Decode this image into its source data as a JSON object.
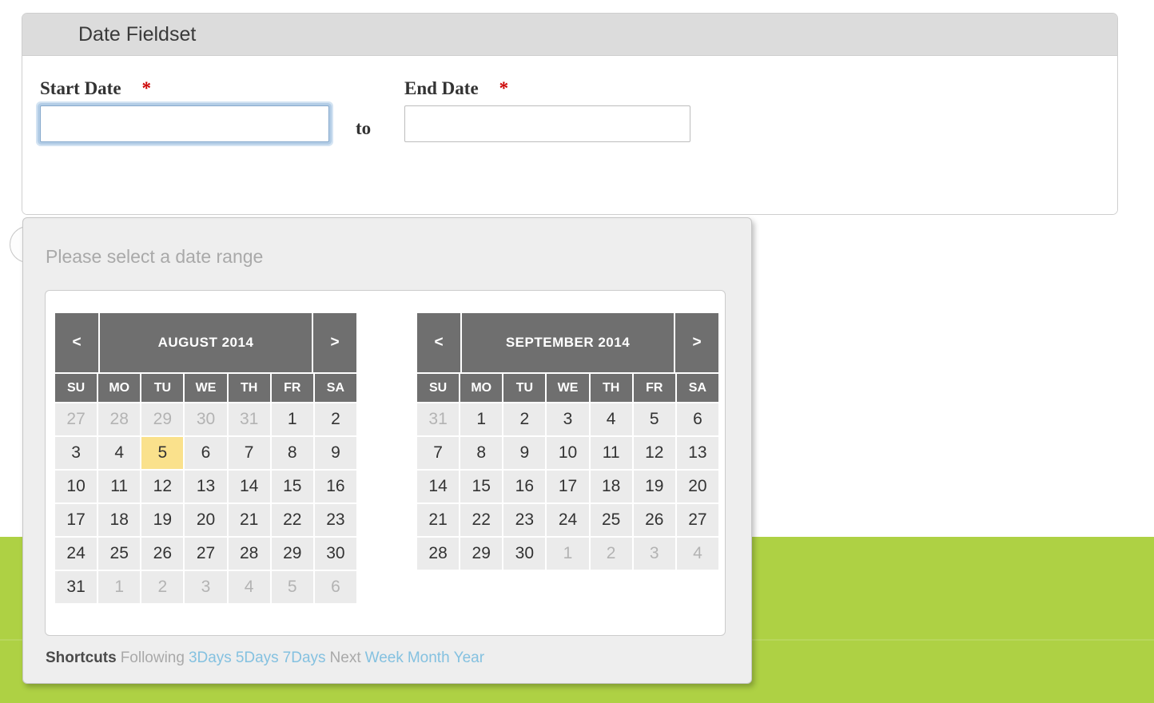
{
  "fieldset": {
    "legend": "Date Fieldset",
    "start": {
      "label": "Start Date",
      "required_marker": "*",
      "value": "",
      "placeholder": ""
    },
    "separator": "to",
    "end": {
      "label": "End Date",
      "required_marker": "*",
      "value": "",
      "placeholder": ""
    }
  },
  "datepicker": {
    "title": "Please select a date range",
    "prev_label": "<",
    "next_label": ">",
    "weekdays": [
      "SU",
      "MO",
      "TU",
      "WE",
      "TH",
      "FR",
      "SA"
    ],
    "calendars": [
      {
        "month_label": "AUGUST 2014",
        "weeks": [
          [
            {
              "d": "27",
              "m": true
            },
            {
              "d": "28",
              "m": true
            },
            {
              "d": "29",
              "m": true
            },
            {
              "d": "30",
              "m": true
            },
            {
              "d": "31",
              "m": true
            },
            {
              "d": "1",
              "m": false
            },
            {
              "d": "2",
              "m": false
            }
          ],
          [
            {
              "d": "3",
              "m": false
            },
            {
              "d": "4",
              "m": false
            },
            {
              "d": "5",
              "m": false,
              "today": true
            },
            {
              "d": "6",
              "m": false
            },
            {
              "d": "7",
              "m": false
            },
            {
              "d": "8",
              "m": false
            },
            {
              "d": "9",
              "m": false
            }
          ],
          [
            {
              "d": "10",
              "m": false
            },
            {
              "d": "11",
              "m": false
            },
            {
              "d": "12",
              "m": false
            },
            {
              "d": "13",
              "m": false
            },
            {
              "d": "14",
              "m": false
            },
            {
              "d": "15",
              "m": false
            },
            {
              "d": "16",
              "m": false
            }
          ],
          [
            {
              "d": "17",
              "m": false
            },
            {
              "d": "18",
              "m": false
            },
            {
              "d": "19",
              "m": false
            },
            {
              "d": "20",
              "m": false
            },
            {
              "d": "21",
              "m": false
            },
            {
              "d": "22",
              "m": false
            },
            {
              "d": "23",
              "m": false
            }
          ],
          [
            {
              "d": "24",
              "m": false
            },
            {
              "d": "25",
              "m": false
            },
            {
              "d": "26",
              "m": false
            },
            {
              "d": "27",
              "m": false
            },
            {
              "d": "28",
              "m": false
            },
            {
              "d": "29",
              "m": false
            },
            {
              "d": "30",
              "m": false
            }
          ],
          [
            {
              "d": "31",
              "m": false
            },
            {
              "d": "1",
              "m": true
            },
            {
              "d": "2",
              "m": true
            },
            {
              "d": "3",
              "m": true
            },
            {
              "d": "4",
              "m": true
            },
            {
              "d": "5",
              "m": true
            },
            {
              "d": "6",
              "m": true
            }
          ]
        ]
      },
      {
        "month_label": "SEPTEMBER 2014",
        "weeks": [
          [
            {
              "d": "31",
              "m": true
            },
            {
              "d": "1",
              "m": false
            },
            {
              "d": "2",
              "m": false
            },
            {
              "d": "3",
              "m": false
            },
            {
              "d": "4",
              "m": false
            },
            {
              "d": "5",
              "m": false
            },
            {
              "d": "6",
              "m": false
            }
          ],
          [
            {
              "d": "7",
              "m": false
            },
            {
              "d": "8",
              "m": false
            },
            {
              "d": "9",
              "m": false
            },
            {
              "d": "10",
              "m": false
            },
            {
              "d": "11",
              "m": false
            },
            {
              "d": "12",
              "m": false
            },
            {
              "d": "13",
              "m": false
            }
          ],
          [
            {
              "d": "14",
              "m": false
            },
            {
              "d": "15",
              "m": false
            },
            {
              "d": "16",
              "m": false
            },
            {
              "d": "17",
              "m": false
            },
            {
              "d": "18",
              "m": false
            },
            {
              "d": "19",
              "m": false
            },
            {
              "d": "20",
              "m": false
            }
          ],
          [
            {
              "d": "21",
              "m": false
            },
            {
              "d": "22",
              "m": false
            },
            {
              "d": "23",
              "m": false
            },
            {
              "d": "24",
              "m": false
            },
            {
              "d": "25",
              "m": false
            },
            {
              "d": "26",
              "m": false
            },
            {
              "d": "27",
              "m": false
            }
          ],
          [
            {
              "d": "28",
              "m": false
            },
            {
              "d": "29",
              "m": false
            },
            {
              "d": "30",
              "m": false
            },
            {
              "d": "1",
              "m": true
            },
            {
              "d": "2",
              "m": true
            },
            {
              "d": "3",
              "m": true
            },
            {
              "d": "4",
              "m": true
            }
          ]
        ]
      }
    ],
    "shortcuts": {
      "title": "Shortcuts",
      "items": [
        {
          "text": "Following",
          "kind": "word"
        },
        {
          "text": "3Days",
          "kind": "link"
        },
        {
          "text": "5Days",
          "kind": "link"
        },
        {
          "text": "7Days",
          "kind": "link"
        },
        {
          "text": "Next",
          "kind": "word"
        },
        {
          "text": "Week",
          "kind": "link"
        },
        {
          "text": "Month",
          "kind": "link"
        },
        {
          "text": "Year",
          "kind": "link"
        }
      ]
    }
  },
  "colors": {
    "band_green": "#aed144",
    "header_gray": "#6f6f6f",
    "today_yellow": "#fae18c",
    "link_blue": "#84c1e0",
    "required_red": "#cc0000"
  }
}
